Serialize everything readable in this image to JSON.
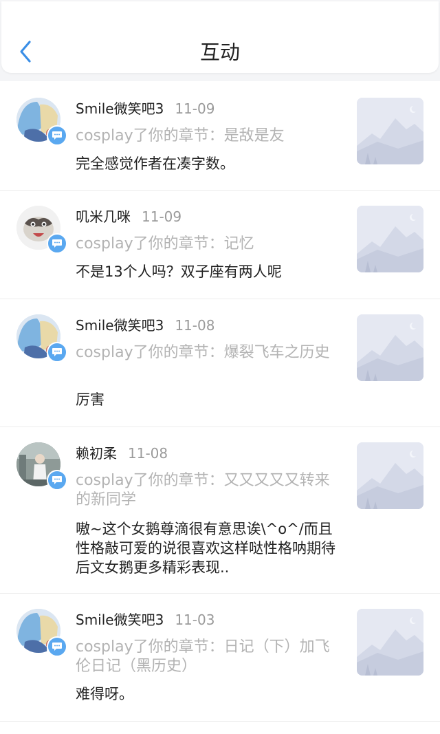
{
  "header": {
    "title": "互动"
  },
  "items": [
    {
      "name": "Smile微笑吧3",
      "date": "11-09",
      "ref": "cosplay了你的章节：是敌是友",
      "comment": "完全感觉作者在凑字数。"
    },
    {
      "name": "叽米几咪",
      "date": "11-09",
      "ref": "cosplay了你的章节：记忆",
      "comment": "不是13个人吗？双子座有两人呢"
    },
    {
      "name": "Smile微笑吧3",
      "date": "11-08",
      "ref": "cosplay了你的章节：爆裂飞车之历史",
      "comment": "厉害"
    },
    {
      "name": "赖初柔",
      "date": "11-08",
      "ref": "cosplay了你的章节：又又又又又转来的新同学",
      "comment": "嗷~这个女鹅尊滴很有意思诶\\^o^/而且性格敲可爱的说很喜欢这样哒性格呐期待后文女鹅更多精彩表现.."
    },
    {
      "name": "Smile微笑吧3",
      "date": "11-03",
      "ref": "cosplay了你的章节：日记（下）加飞伦日记（黑历史）",
      "comment": "难得呀。"
    }
  ]
}
